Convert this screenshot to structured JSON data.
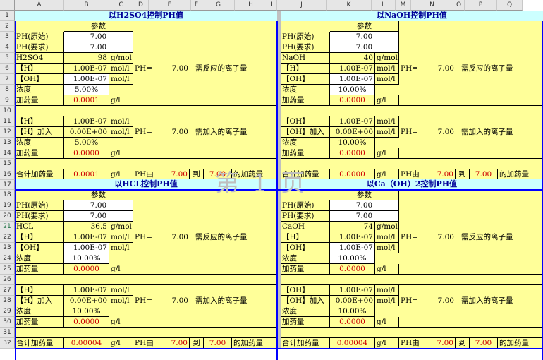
{
  "columns": [
    "A",
    "B",
    "C",
    "D",
    "E",
    "F",
    "G",
    "H",
    "I",
    "J",
    "K",
    "L",
    "M",
    "N",
    "O",
    "P",
    "Q"
  ],
  "rows": [
    "1",
    "2",
    "3",
    "4",
    "5",
    "6",
    "7",
    "8",
    "9",
    "10",
    "11",
    "12",
    "13",
    "14",
    "15",
    "16",
    "17",
    "18",
    "19",
    "20",
    "21",
    "22",
    "23",
    "24",
    "25",
    "26",
    "27",
    "28",
    "29",
    "30",
    "31",
    "32"
  ],
  "watermark": "第 1 页",
  "panels": [
    {
      "title": "以H2SO4控制PH值",
      "param": "参数",
      "ph_orig_label": "PH(原始)",
      "ph_orig": "7.00",
      "ph_req_label": "PH(要求)",
      "ph_req": "7.00",
      "chem_label": "H2SO4",
      "chem_val": "98",
      "chem_unit": "g/mol",
      "h_label": "【H】",
      "h_val": "1.00E-07",
      "h_unit": "mol/l",
      "oh_label": "【OH】",
      "oh_val": "1.00E-07",
      "oh_unit": "mol/l",
      "conc_label": "浓度",
      "conc_val": "5.00%",
      "dose_label": "加药量",
      "dose_val": "0.0001",
      "dose_unit": "g/l",
      "ph_eq": "PH=",
      "ph_value": "7.00",
      "ion_text": "需反应的离子量",
      "s2_h_label": "【H】",
      "s2_h_val": "1.00E-07",
      "s2_h_unit": "mol/l",
      "s2_add_label": "【H】加入",
      "s2_add_val": "0.00E+00",
      "s2_add_unit": "mol/l",
      "s2_conc_label": "浓度",
      "s2_conc_val": "5.00%",
      "s2_dose_label": "加药量",
      "s2_dose_val": "0.0000",
      "s2_dose_unit": "g/l",
      "s2_ph_eq": "PH=",
      "s2_ph_value": "7.00",
      "s2_ion_text": "需加入的离子量",
      "total_label": "合计加药量",
      "total_val": "0.0001",
      "total_unit": "g/l",
      "from_label": "PH由",
      "from_val": "7.00",
      "to_label": "到",
      "to_val": "7.00",
      "add_text": "的加药量"
    },
    {
      "title": "以NaOH控制PH值",
      "param": "参数",
      "ph_orig_label": "PH(原始)",
      "ph_orig": "7.00",
      "ph_req_label": "PH(要求)",
      "ph_req": "7.00",
      "chem_label": "NaOH",
      "chem_val": "40",
      "chem_unit": "g/mol",
      "h_label": "【H】",
      "h_val": "1.00E-07",
      "h_unit": "mol/l",
      "oh_label": "【OH】",
      "oh_val": "1.00E-07",
      "oh_unit": "mol/l",
      "conc_label": "浓度",
      "conc_val": "10.00%",
      "dose_label": "加药量",
      "dose_val": "0.0000",
      "dose_unit": "g/l",
      "ph_eq": "PH=",
      "ph_value": "7.00",
      "ion_text": "需反应的离子量",
      "s2_h_label": "【OH】",
      "s2_h_val": "1.00E-07",
      "s2_h_unit": "mol/l",
      "s2_add_label": "【OH】加入",
      "s2_add_val": "0.00E+00",
      "s2_add_unit": "mol/l",
      "s2_conc_label": "浓度",
      "s2_conc_val": "10.00%",
      "s2_dose_label": "加药量",
      "s2_dose_val": "0.0000",
      "s2_dose_unit": "g/l",
      "s2_ph_eq": "PH=",
      "s2_ph_value": "7.00",
      "s2_ion_text": "需加入的离子量",
      "total_label": "合计加药量",
      "total_val": "0.0000",
      "total_unit": "g/l",
      "from_label": "PH由",
      "from_val": "7.00",
      "to_label": "到",
      "to_val": "7.00",
      "add_text": "的加药量"
    },
    {
      "title": "以HCL控制PH值",
      "param": "参数",
      "ph_orig_label": "PH(原始)",
      "ph_orig": "7.00",
      "ph_req_label": "PH(要求)",
      "ph_req": "7.00",
      "chem_label": "HCL",
      "chem_val": "36.5",
      "chem_unit": "g/mol",
      "h_label": "【H】",
      "h_val": "1.00E-07",
      "h_unit": "mol/l",
      "oh_label": "【OH】",
      "oh_val": "1.00E-07",
      "oh_unit": "mol/l",
      "conc_label": "浓度",
      "conc_val": "10.00%",
      "dose_label": "加药量",
      "dose_val": "0.0000",
      "dose_unit": "g/l",
      "ph_eq": "PH=",
      "ph_value": "7.00",
      "ion_text": "需反应的离子量",
      "s2_h_label": "【H】",
      "s2_h_val": "1.00E-07",
      "s2_h_unit": "mol/l",
      "s2_add_label": "【H】加入",
      "s2_add_val": "0.00E+00",
      "s2_add_unit": "mol/l",
      "s2_conc_label": "浓度",
      "s2_conc_val": "10.00%",
      "s2_dose_label": "加药量",
      "s2_dose_val": "0.0000",
      "s2_dose_unit": "g/l",
      "s2_ph_eq": "PH=",
      "s2_ph_value": "7.00",
      "s2_ion_text": "需加入的离子量",
      "total_label": "合计加药量",
      "total_val": "0.00004",
      "total_unit": "g/l",
      "from_label": "PH由",
      "from_val": "7.00",
      "to_label": "到",
      "to_val": "7.00",
      "add_text": "的加药量"
    },
    {
      "title": "以Ca（OH）2控制PH值",
      "param": "参数",
      "ph_orig_label": "PH(原始)",
      "ph_orig": "7.00",
      "ph_req_label": "PH(要求)",
      "ph_req": "7.00",
      "chem_label": "CaOH",
      "chem_val": "74",
      "chem_unit": "g/mol",
      "h_label": "【H】",
      "h_val": "1.00E-07",
      "h_unit": "mol/l",
      "oh_label": "【OH】",
      "oh_val": "1.00E-07",
      "oh_unit": "mol/l",
      "conc_label": "浓度",
      "conc_val": "10.00%",
      "dose_label": "加药量",
      "dose_val": "0.0000",
      "dose_unit": "g/l",
      "ph_eq": "PH=",
      "ph_value": "7.00",
      "ion_text": "需反应的离子量",
      "s2_h_label": "【OH】",
      "s2_h_val": "1.00E-07",
      "s2_h_unit": "mol/l",
      "s2_add_label": "【OH】加入",
      "s2_add_val": "0.00E+00",
      "s2_add_unit": "mol/l",
      "s2_conc_label": "浓度",
      "s2_conc_val": "10.00%",
      "s2_dose_label": "加药量",
      "s2_dose_val": "0.0000",
      "s2_dose_unit": "g/l",
      "s2_ph_eq": "PH=",
      "s2_ph_value": "7.00",
      "s2_ion_text": "需加入的离子量",
      "total_label": "合计加药量",
      "total_val": "0.00004",
      "total_unit": "g/l",
      "from_label": "PH由",
      "from_val": "7.00",
      "to_label": "到",
      "to_val": "7.00",
      "add_text": "的加药量"
    }
  ]
}
